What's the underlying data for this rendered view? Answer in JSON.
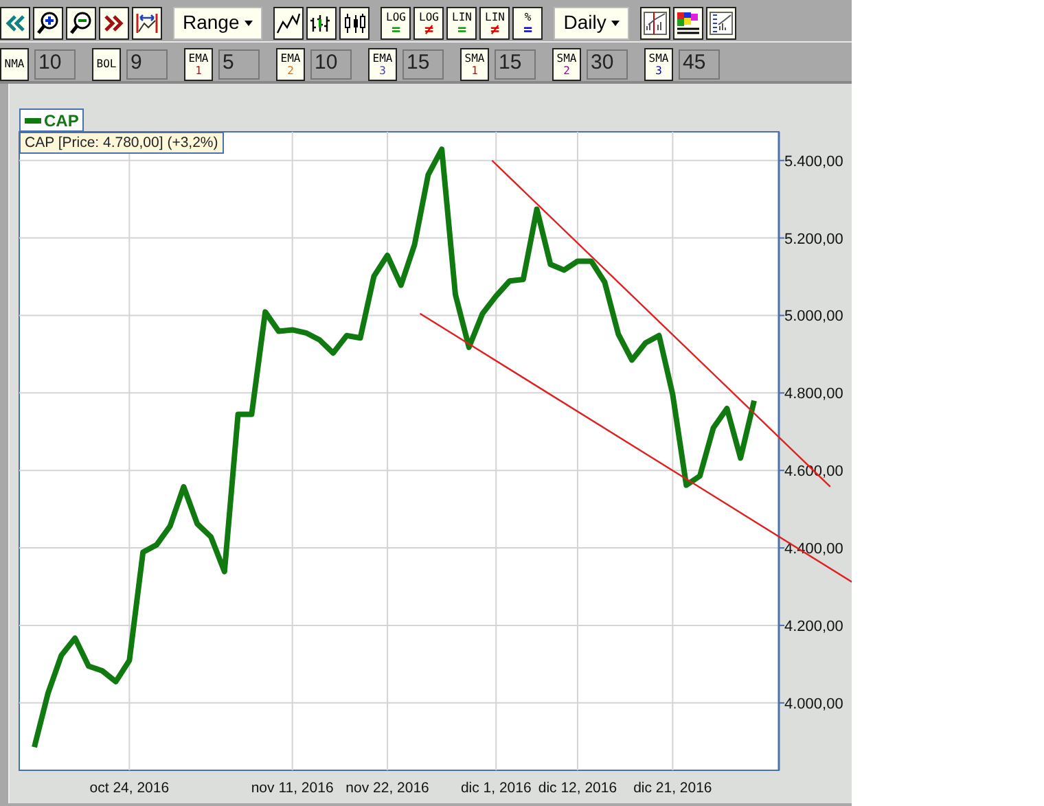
{
  "toolbar": {
    "range_dropdown": {
      "label": "Range"
    },
    "scale_buttons": [
      {
        "label": "LOG",
        "symbol": "=",
        "color": "#00a000"
      },
      {
        "label": "LOG",
        "symbol": "≠",
        "color": "#e00000"
      },
      {
        "label": "LIN",
        "symbol": "=",
        "color": "#00a000"
      },
      {
        "label": "LIN",
        "symbol": "≠",
        "color": "#e00000"
      },
      {
        "label": "%",
        "symbol": "=",
        "color": "#0000e0"
      }
    ],
    "period_dropdown": {
      "label": "Daily"
    }
  },
  "indicators": [
    {
      "label": "NMA",
      "value": "10"
    },
    {
      "label": "BOL",
      "value": "9"
    },
    {
      "label": "EMA",
      "index": "1",
      "color": "#d00000",
      "value": "5"
    },
    {
      "label": "EMA",
      "index": "2",
      "color": "#e07000",
      "value": "10"
    },
    {
      "label": "EMA",
      "index": "3",
      "color": "#4040c0",
      "value": "15"
    },
    {
      "label": "SMA",
      "index": "1",
      "color": "#d00000",
      "value": "15"
    },
    {
      "label": "SMA",
      "index": "2",
      "color": "#a000a0",
      "value": "30"
    },
    {
      "label": "SMA",
      "index": "3",
      "color": "#0000d0",
      "value": "45"
    }
  ],
  "chart": {
    "tooltip": "CAP [Price: 4.780,00] (+3,2%)",
    "chart_data": {
      "type": "line",
      "categories": [
        null,
        null,
        null,
        null,
        null,
        null,
        null,
        "oct 24, 2016",
        null,
        null,
        null,
        null,
        null,
        null,
        null,
        null,
        null,
        null,
        null,
        "nov 11, 2016",
        null,
        null,
        null,
        null,
        null,
        null,
        "nov 22, 2016",
        null,
        null,
        null,
        null,
        null,
        null,
        null,
        "dic 1, 2016",
        null,
        null,
        null,
        null,
        null,
        "dic 12, 2016",
        null,
        null,
        null,
        null,
        null,
        null,
        "dic 21, 2016",
        null,
        null,
        null,
        null,
        null,
        null
      ],
      "series": [
        {
          "name": "CAP",
          "color": "#107a10",
          "values": [
            3886,
            4024,
            4123,
            4167,
            4095,
            4083,
            4055,
            4110,
            4389,
            4408,
            4456,
            4558,
            4462,
            4429,
            4339,
            4745,
            4745,
            5009,
            4959,
            4963,
            4955,
            4937,
            4903,
            4948,
            4942,
            5101,
            5155,
            5078,
            5183,
            5363,
            5429,
            5054,
            4918,
            5005,
            5050,
            5089,
            5093,
            5274,
            5132,
            5117,
            5140,
            5140,
            5086,
            4952,
            4885,
            4929,
            4948,
            4796,
            4562,
            4586,
            4710,
            4760,
            4632,
            4780
          ]
        }
      ],
      "ylim": [
        3826,
        5474
      ],
      "grid": true,
      "yticks": [
        {
          "value": 4000,
          "label": "4.000,00"
        },
        {
          "value": 4200,
          "label": "4.200,00"
        },
        {
          "value": 4400,
          "label": "4.400,00"
        },
        {
          "value": 4600,
          "label": "4.600,00"
        },
        {
          "value": 4800,
          "label": "4.800,00"
        },
        {
          "value": 5000,
          "label": "5.000,00"
        },
        {
          "value": 5200,
          "label": "5.200,00"
        },
        {
          "value": 5400,
          "label": "5.400,00"
        }
      ]
    }
  }
}
